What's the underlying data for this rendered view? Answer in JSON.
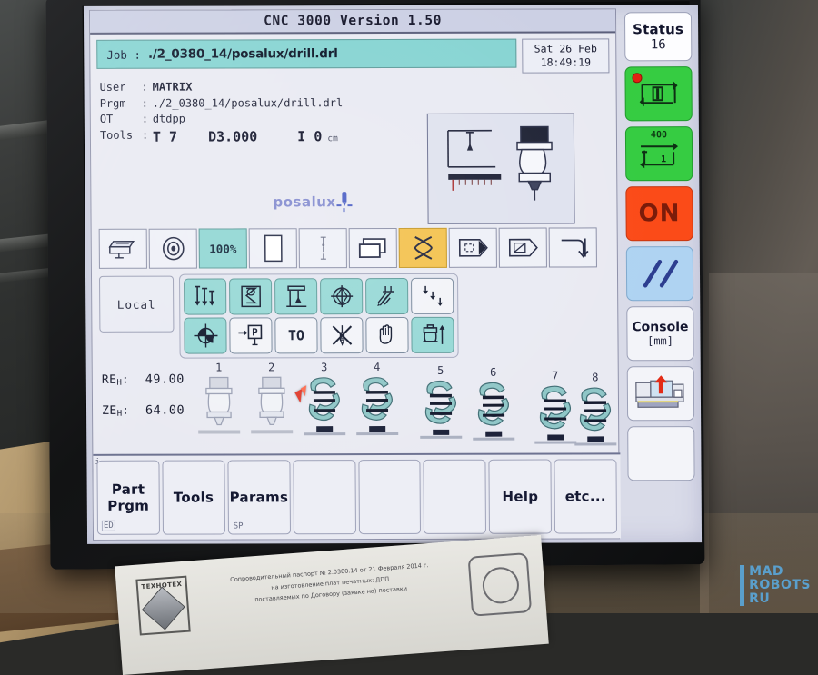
{
  "window": {
    "title": "CNC 3000   Version 1.50"
  },
  "job": {
    "label": "Job  :",
    "path": "./2_0380_14/posalux/drill.drl"
  },
  "clock": {
    "date": "Sat 26 Feb",
    "time": "18:49:19"
  },
  "info": {
    "user_key": "User",
    "user_val": "MATRIX",
    "prgm_key": "Prgm",
    "prgm_val": "./2_0380_14/posalux/drill.drl",
    "ot_key": "OT",
    "ot_val": "dtdpp",
    "tools_key": "Tools",
    "tool_no": "T 7",
    "tool_dia": "D3.000",
    "tool_i": "I 0",
    "tool_unit": "cm",
    "sep": ":"
  },
  "brand": {
    "logo_text": "posalux"
  },
  "toolbar_row1": [
    {
      "name": "print-head-icon",
      "style": "plain",
      "label": ""
    },
    {
      "name": "target-ring-icon",
      "style": "plain",
      "label": ""
    },
    {
      "name": "feed-percent-icon",
      "style": "teal",
      "label": "100%"
    },
    {
      "name": "blank-page-icon",
      "style": "plain",
      "label": ""
    },
    {
      "name": "measure-probe-icon",
      "style": "plain",
      "label": ""
    },
    {
      "name": "window-layers-icon",
      "style": "plain",
      "label": ""
    },
    {
      "name": "cross-swap-icon",
      "style": "amber",
      "label": ""
    },
    {
      "name": "block-forward-icon",
      "style": "plain",
      "label": ""
    },
    {
      "name": "block-slash-icon",
      "style": "plain",
      "label": ""
    },
    {
      "name": "jump-end-icon",
      "style": "plain",
      "label": ""
    }
  ],
  "local_button": {
    "label": "Local"
  },
  "toolbar_row2": [
    {
      "name": "multi-down-arrows-icon",
      "style": "teal",
      "label": ""
    },
    {
      "name": "hourglass-gauge-icon",
      "style": "teal",
      "label": ""
    },
    {
      "name": "tool-length-icon",
      "style": "teal",
      "label": ""
    },
    {
      "name": "center-circle-icon",
      "style": "teal",
      "label": ""
    },
    {
      "name": "drill-angle-icon",
      "style": "teal",
      "label": ""
    },
    {
      "name": "step-down-icon",
      "style": "plain",
      "label": ""
    }
  ],
  "toolbar_row3": [
    {
      "name": "quadrant-target-icon",
      "style": "teal",
      "label": ""
    },
    {
      "name": "goto-point-p-icon",
      "style": "plain",
      "label": ""
    },
    {
      "name": "to-button",
      "style": "plain",
      "label": "TO"
    },
    {
      "name": "cancel-tool-icon",
      "style": "plain",
      "label": ""
    },
    {
      "name": "hand-stop-icon",
      "style": "plain",
      "label": ""
    },
    {
      "name": "spindle-up-icon",
      "style": "teal",
      "label": ""
    }
  ],
  "coords": [
    {
      "name": "RE",
      "sub": "H",
      "sep": ":",
      "value": "49.00"
    },
    {
      "name": "ZE",
      "sub": "H",
      "sep": ":",
      "value": "64.00"
    }
  ],
  "spindles": [
    {
      "num": "1",
      "active": false
    },
    {
      "num": "2",
      "active": false
    },
    {
      "num": "3",
      "active": true
    },
    {
      "num": "4",
      "active": true
    },
    {
      "num": "5",
      "active": true
    },
    {
      "num": "6",
      "active": true
    },
    {
      "num": "7",
      "active": true
    },
    {
      "num": "8",
      "active": true
    }
  ],
  "function_keys": [
    {
      "label": "Part\nPrgm",
      "corner": "ED",
      "corner_pos": "bottom"
    },
    {
      "label": "Tools",
      "corner": "",
      "corner_pos": ""
    },
    {
      "label": "Params",
      "corner": "SP",
      "corner_pos": "bottom-plain"
    },
    {
      "label": "",
      "corner": "",
      "corner_pos": ""
    },
    {
      "label": "",
      "corner": "",
      "corner_pos": ""
    },
    {
      "label": "",
      "corner": "",
      "corner_pos": ""
    },
    {
      "label": "Help",
      "corner": "",
      "corner_pos": ""
    },
    {
      "label": "etc...",
      "corner": "",
      "corner_pos": ""
    }
  ],
  "fkey_info_glyph": "i",
  "status_column": {
    "status_title": "Status",
    "status_value": "16",
    "cycle_single_name": "cycle-single-part-button",
    "cycle_count_name": "cycle-repeat-button",
    "cycle_count_top": "400",
    "cycle_count_inner": "1",
    "on_label": "ON",
    "parallel_name": "parallel-lines-button",
    "console_label": "Console",
    "console_unit": "[mm]",
    "machine_name": "machine-load-button"
  },
  "document": {
    "seal_text": "ТЕХНОТЕХ",
    "lines": [
      "Сопроводительный паспорт № 2.0380.14 от 21 Февраля 2014 г.",
      "на изготовление плат печатных: ДПП",
      "поставляемых по Договору (заявке на) поставки"
    ]
  },
  "watermark": {
    "line1": "MAD",
    "line2": "ROBOTS",
    "line3": "RU"
  },
  "colors": {
    "teal": "#8fd6d3",
    "amber": "#f3c14b",
    "green": "#34cc3f",
    "red": "#fb4a14",
    "blue": "#aed3f2",
    "screen_bg": "#e9eaf2",
    "watermark": "#5aa6d8"
  }
}
